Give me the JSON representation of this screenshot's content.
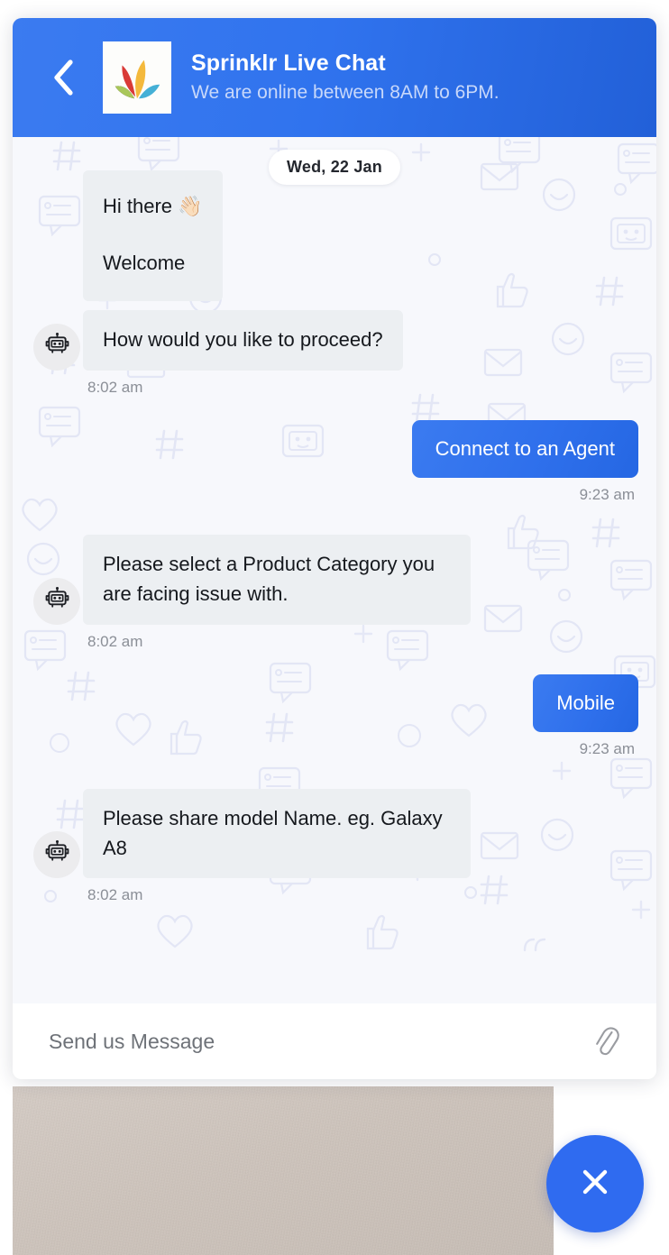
{
  "header": {
    "back_icon": "chevron-left-icon",
    "logo_alt": "sprinklr-logo",
    "title": "Sprinklr Live Chat",
    "subtitle": "We are online between 8AM to 6PM.",
    "gradient_from": "#3b7bf0",
    "gradient_to": "#2260d8"
  },
  "conversation": {
    "date_divider": "Wed, 22 Jan",
    "messages": [
      {
        "sender": "bot",
        "lines": [
          "Hi there 👋🏻",
          "Welcome"
        ],
        "timestamp": null
      },
      {
        "sender": "bot",
        "lines": [
          "How would you like to proceed?"
        ],
        "timestamp": "8:02 am"
      },
      {
        "sender": "user",
        "lines": [
          "Connect to an Agent"
        ],
        "timestamp": "9:23 am"
      },
      {
        "sender": "bot",
        "lines": [
          "Please select a Product Category you are facing issue with."
        ],
        "timestamp": "8:02 am"
      },
      {
        "sender": "user",
        "lines": [
          "Mobile"
        ],
        "timestamp": "9:23 am"
      },
      {
        "sender": "bot",
        "lines": [
          "Please share model Name. eg. Galaxy A8"
        ],
        "timestamp": "8:02 am"
      }
    ],
    "bot_avatar_icon": "robot-icon",
    "bot_bubble_color": "#eceff2",
    "user_bubble_color": "#2f70ec"
  },
  "composer": {
    "placeholder": "Send us Message",
    "value": "",
    "attach_icon": "paperclip-icon"
  },
  "fab": {
    "close_icon": "close-icon",
    "color": "#2f6bf0"
  }
}
